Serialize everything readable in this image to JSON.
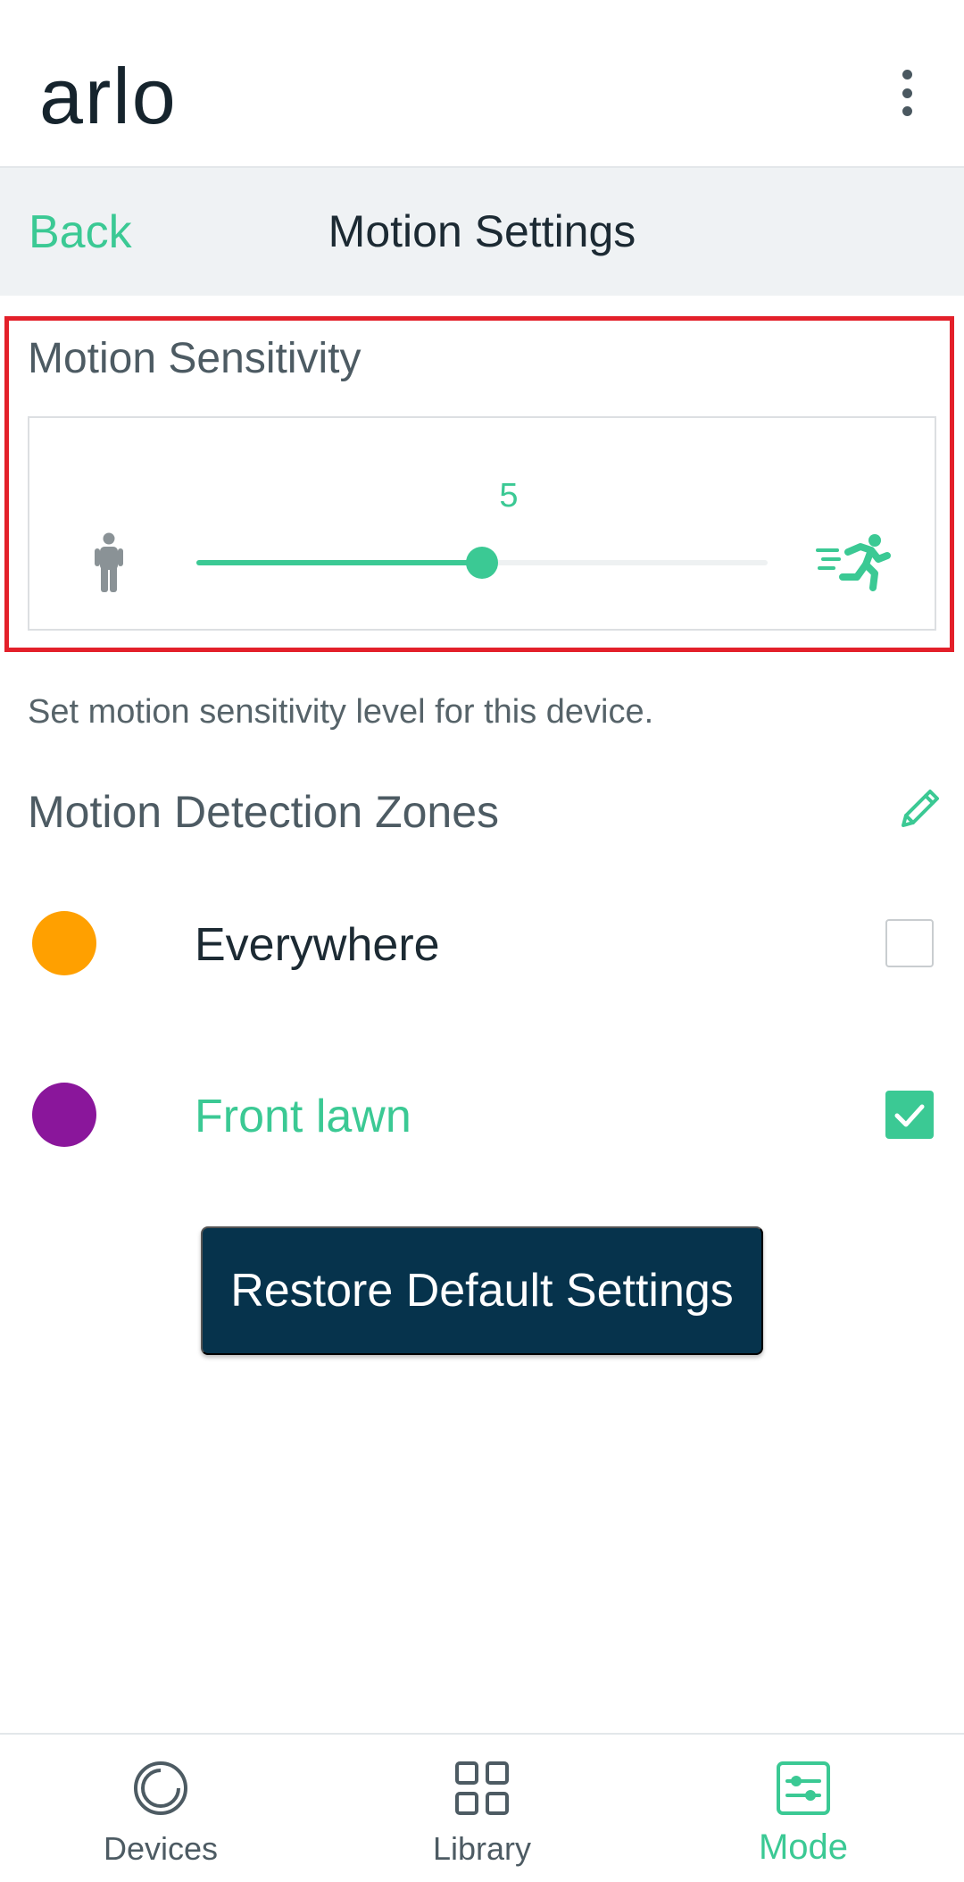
{
  "app": {
    "logo_text": "arlo",
    "brand_color": "#3bc994"
  },
  "header": {
    "back_label": "Back",
    "title": "Motion Settings"
  },
  "sensitivity": {
    "title": "Motion Sensitivity",
    "value": 5,
    "value_label": "5",
    "max": 10,
    "fraction": 0.5,
    "low_icon": "walking-person-icon",
    "high_icon": "running-person-icon",
    "helper_text": "Set motion sensitivity level for this device."
  },
  "zones": {
    "title": "Motion Detection Zones",
    "edit_icon": "pencil-icon",
    "items": [
      {
        "name": "Everywhere",
        "color": "#ffa000",
        "checked": false
      },
      {
        "name": "Front lawn",
        "color": "#8a169b",
        "checked": true
      }
    ]
  },
  "actions": {
    "restore_label": "Restore Default Settings"
  },
  "nav": {
    "items": [
      {
        "label": "Devices",
        "icon": "camera-lens-icon",
        "active": false
      },
      {
        "label": "Library",
        "icon": "grid-icon",
        "active": false
      },
      {
        "label": "Mode",
        "icon": "sliders-icon",
        "active": true
      }
    ]
  }
}
